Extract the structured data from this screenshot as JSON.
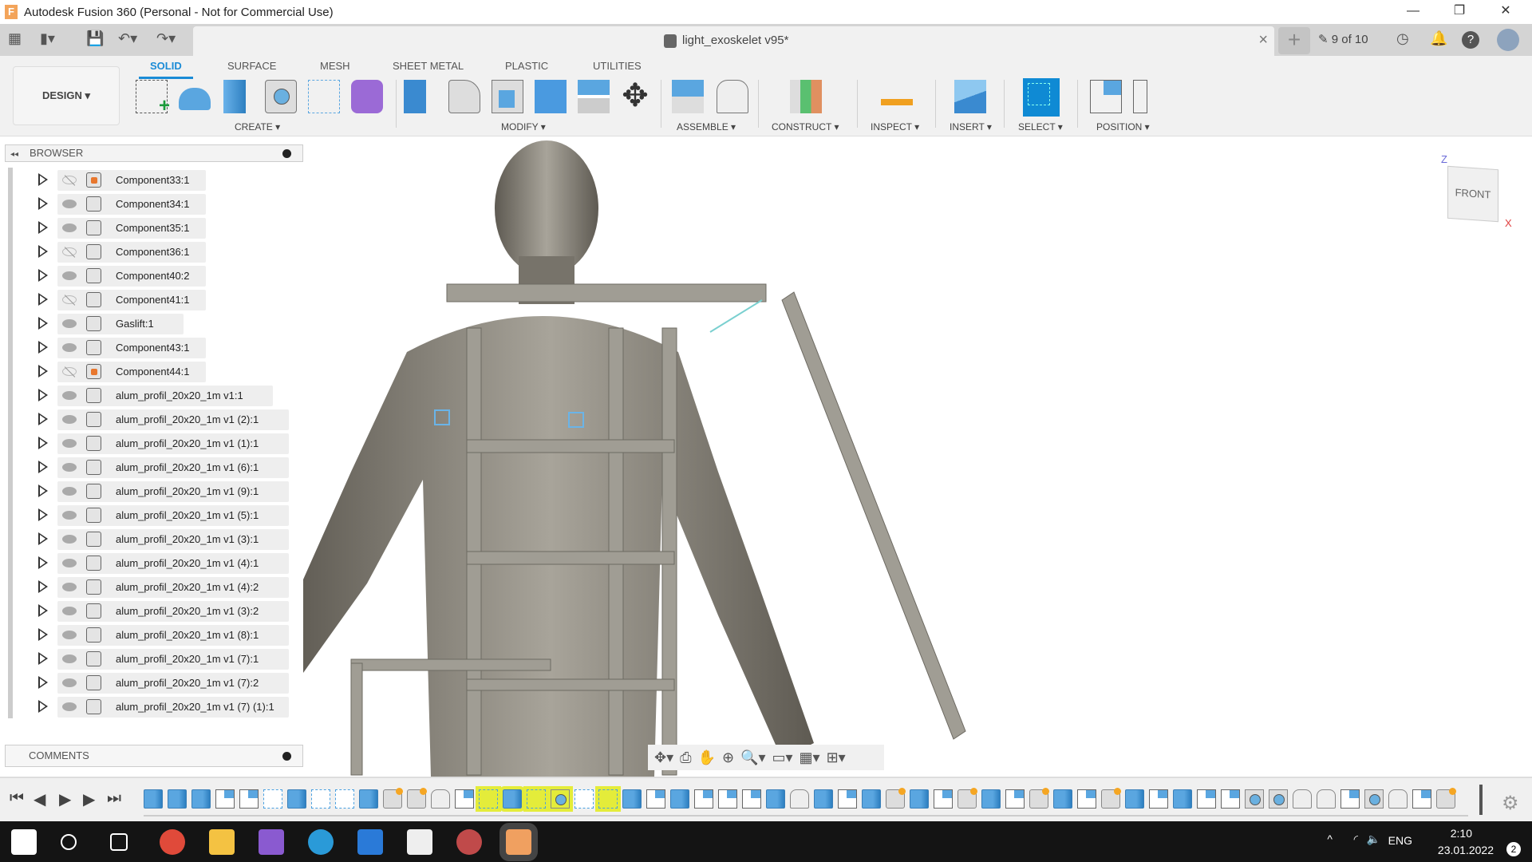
{
  "window": {
    "title": "Autodesk Fusion 360 (Personal - Not for Commercial Use)",
    "logo": "F",
    "minimize": "—",
    "restore": "❐",
    "close": "✕"
  },
  "quick_access": {
    "grid_icon": "▦",
    "file_icon": "▮▾",
    "save_icon": "💾",
    "undo_icon": "↶▾",
    "redo_icon": "↷▾"
  },
  "document": {
    "name": "light_exoskelet v95*",
    "close": "×",
    "new_tab": "+"
  },
  "header_right": {
    "versions": "9 of 10"
  },
  "workspace": {
    "label": "DESIGN ▾"
  },
  "tabs": [
    {
      "label": "SOLID",
      "active": true
    },
    {
      "label": "SURFACE"
    },
    {
      "label": "MESH"
    },
    {
      "label": "SHEET METAL"
    },
    {
      "label": "PLASTIC"
    },
    {
      "label": "UTILITIES"
    }
  ],
  "groups": {
    "create": "CREATE ▾",
    "modify": "MODIFY ▾",
    "assemble": "ASSEMBLE ▾",
    "construct": "CONSTRUCT ▾",
    "inspect": "INSPECT ▾",
    "insert": "INSERT ▾",
    "select": "SELECT ▾",
    "position": "POSITION ▾"
  },
  "browser": {
    "title": "BROWSER",
    "collapse": "◂◂",
    "items": [
      {
        "label": "Component33:1",
        "visible": false,
        "pinned": true
      },
      {
        "label": "Component34:1",
        "visible": true
      },
      {
        "label": "Component35:1",
        "visible": true
      },
      {
        "label": "Component36:1",
        "visible": false
      },
      {
        "label": "Component40:2",
        "visible": true
      },
      {
        "label": "Component41:1",
        "visible": false
      },
      {
        "label": "Gaslift:1",
        "visible": true
      },
      {
        "label": "Component43:1",
        "visible": true
      },
      {
        "label": "Component44:1",
        "visible": false,
        "pinned": true
      },
      {
        "label": "alum_profil_20x20_1m v1:1",
        "visible": true
      },
      {
        "label": "alum_profil_20x20_1m v1 (2):1",
        "visible": true
      },
      {
        "label": "alum_profil_20x20_1m v1 (1):1",
        "visible": true
      },
      {
        "label": "alum_profil_20x20_1m v1 (6):1",
        "visible": true
      },
      {
        "label": "alum_profil_20x20_1m v1 (9):1",
        "visible": true
      },
      {
        "label": "alum_profil_20x20_1m v1 (5):1",
        "visible": true
      },
      {
        "label": "alum_profil_20x20_1m v1 (3):1",
        "visible": true
      },
      {
        "label": "alum_profil_20x20_1m v1 (4):1",
        "visible": true
      },
      {
        "label": "alum_profil_20x20_1m v1 (4):2",
        "visible": true
      },
      {
        "label": "alum_profil_20x20_1m v1 (3):2",
        "visible": true
      },
      {
        "label": "alum_profil_20x20_1m v1 (8):1",
        "visible": true
      },
      {
        "label": "alum_profil_20x20_1m v1 (7):1",
        "visible": true
      },
      {
        "label": "alum_profil_20x20_1m v1 (7):2",
        "visible": true
      },
      {
        "label": "alum_profil_20x20_1m v1 (7) (1):1",
        "visible": true
      }
    ]
  },
  "comments": {
    "title": "COMMENTS"
  },
  "viewcube": {
    "face": "FRONT",
    "z": "Z",
    "x": "X"
  },
  "timeline": {
    "controls": [
      "⏮",
      "◀",
      "▶",
      "▶",
      "⏭"
    ],
    "items": [
      "feat",
      "feat",
      "feat",
      "plane",
      "plane",
      "sketch",
      "feat",
      "sketch",
      "sketch",
      "feat",
      "comp",
      "comp",
      "joint",
      "plane",
      "sketch*",
      "feat*",
      "sketch*",
      "hole*",
      "sketch",
      "sketch*",
      "feat",
      "plane",
      "feat",
      "plane",
      "plane",
      "plane",
      "feat",
      "joint",
      "feat",
      "plane",
      "feat",
      "comp",
      "feat",
      "plane",
      "comp",
      "feat",
      "plane",
      "comp",
      "feat",
      "plane",
      "comp",
      "feat",
      "plane",
      "feat",
      "plane",
      "plane",
      "hole",
      "hole",
      "joint",
      "joint",
      "plane",
      "hole",
      "joint",
      "plane",
      "comp"
    ]
  },
  "taskbar": {
    "apps": [
      "start",
      "search",
      "task-view",
      "chrome",
      "file-explorer",
      "visual-studio",
      "edge",
      "app",
      "store",
      "chrome-profile",
      "fusion-360"
    ],
    "lang": "ENG",
    "time": "2:10",
    "date": "23.01.2022",
    "notifications": "2"
  },
  "colors": {
    "accent": "#1a8bd6",
    "select_active": "#0f8ad4",
    "highlight": "#e4ec3a"
  }
}
